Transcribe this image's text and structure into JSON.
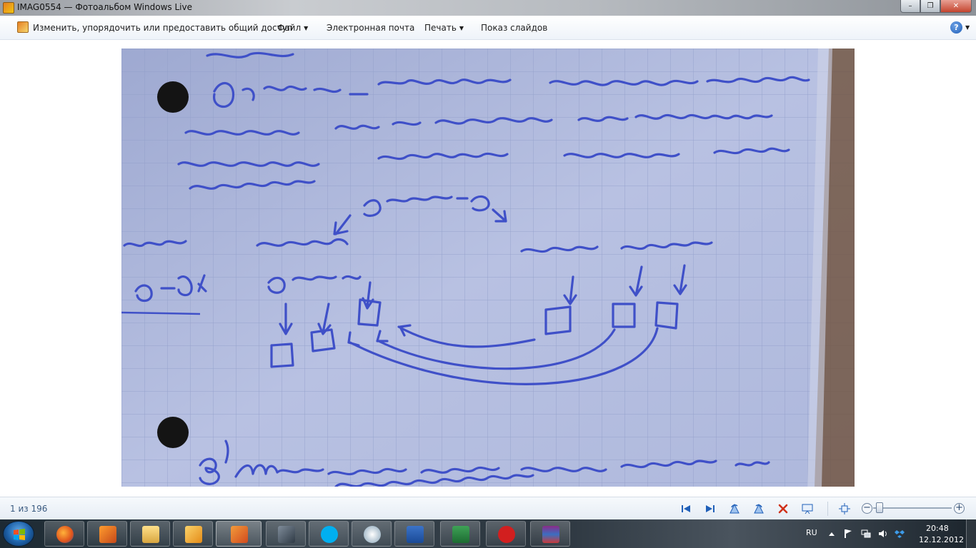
{
  "window": {
    "title": "IMAG0554 — Фотоальбом Windows Live",
    "minimize_glyph": "–",
    "maximize_glyph": "❐",
    "close_glyph": "✕"
  },
  "menubar": {
    "organize_label": "Изменить, упорядочить или предоставить общий доступ",
    "file_label": "Файл",
    "email_label": "Электронная почта",
    "print_label": "Печать",
    "slideshow_label": "Показ слайдов",
    "dropdown_glyph": "▼",
    "help_glyph": "?"
  },
  "statusbar": {
    "counter": "1 из 196",
    "zoom_out_glyph": "−",
    "zoom_in_glyph": "+",
    "zoom_level": 0.04
  },
  "taskbar": {
    "language": "RU",
    "time": "20:48",
    "date": "12.12.2012",
    "apps": [
      "firefox-icon",
      "qip-icon",
      "explorer-icon",
      "media-player-icon",
      "photo-gallery-icon",
      "network-icon",
      "skype-icon",
      "torrent-icon",
      "word-icon",
      "excel-icon",
      "stop-icon",
      "winrar-icon"
    ]
  },
  "colors": {
    "ink": "#3f50c8",
    "paper": "#b3bde0",
    "accent": "#1f5fb8",
    "close": "#c4442e"
  }
}
